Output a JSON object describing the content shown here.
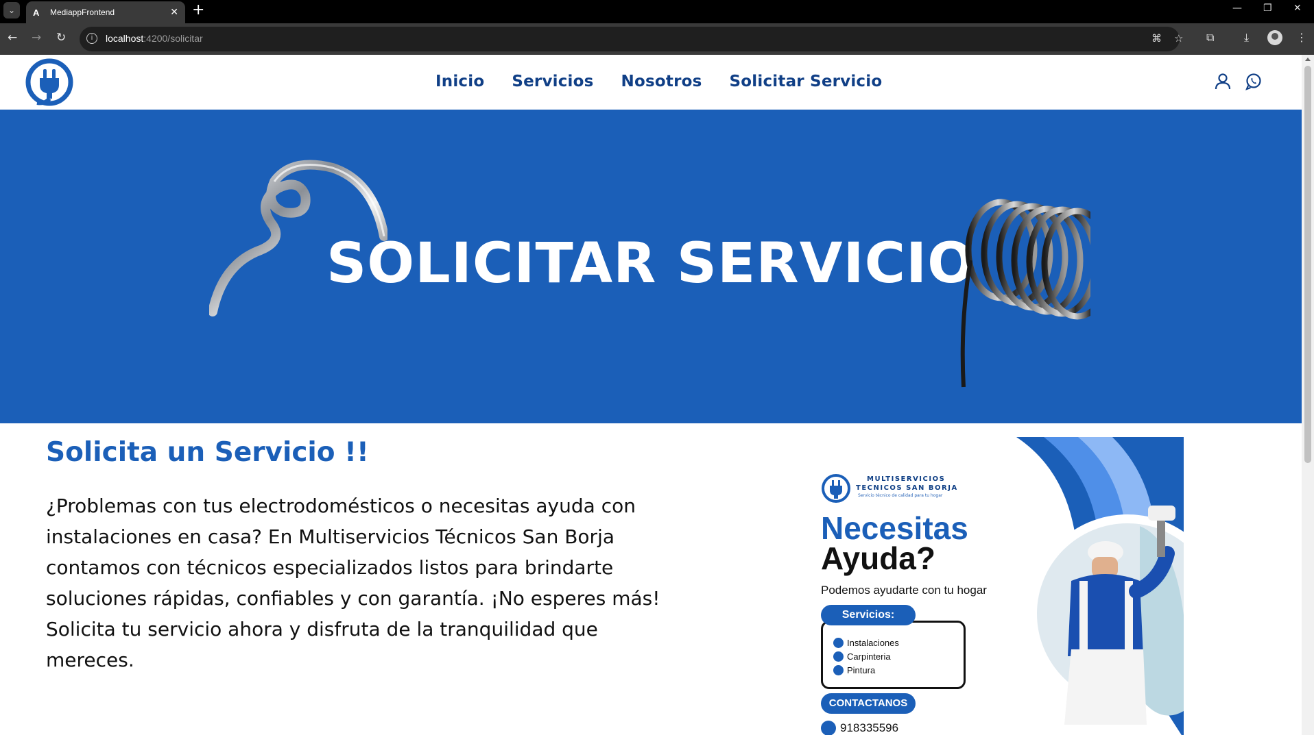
{
  "browser": {
    "tab_favicon": "A",
    "tab_title": "MediappFrontend",
    "tab_close": "✕",
    "new_tab": "+",
    "url_host": "localhost",
    "url_path": ":4200/solicitar",
    "window_controls": [
      "—",
      "❐",
      "✕"
    ]
  },
  "site": {
    "nav": [
      "Inicio",
      "Servicios",
      "Nosotros",
      "Solicitar Servicio"
    ],
    "brand_color": "#1b5fb8",
    "nav_color": "#103f86"
  },
  "hero": {
    "title": "SOLICITAR SERVICIO"
  },
  "content": {
    "title": "Solicita un Servicio !!",
    "text": "¿Problemas con tus electrodomésticos o necesitas ayuda con instalaciones en casa? En Multiservicios Técnicos San Borja contamos con técnicos especializados listos para brindarte soluciones rápidas, confiables y con garantía. ¡No esperes más! Solicita tu servicio ahora y disfruta de la tranquilidad que mereces."
  },
  "flyer": {
    "brand_line1": "MULTISERVICIOS",
    "brand_line2": "TECNICOS SAN BORJA",
    "brand_tagline": "Servicio técnico de calidad para tu hogar",
    "heading1": "Necesitas",
    "heading2": "Ayuda?",
    "subtitle": "Podemos ayudarte con tu hogar",
    "services_label": "Servicios:",
    "services": [
      "Instalaciones",
      "Carpinteria",
      "Pintura"
    ],
    "contact_label": "CONTACTANOS",
    "phone": "918335596"
  }
}
